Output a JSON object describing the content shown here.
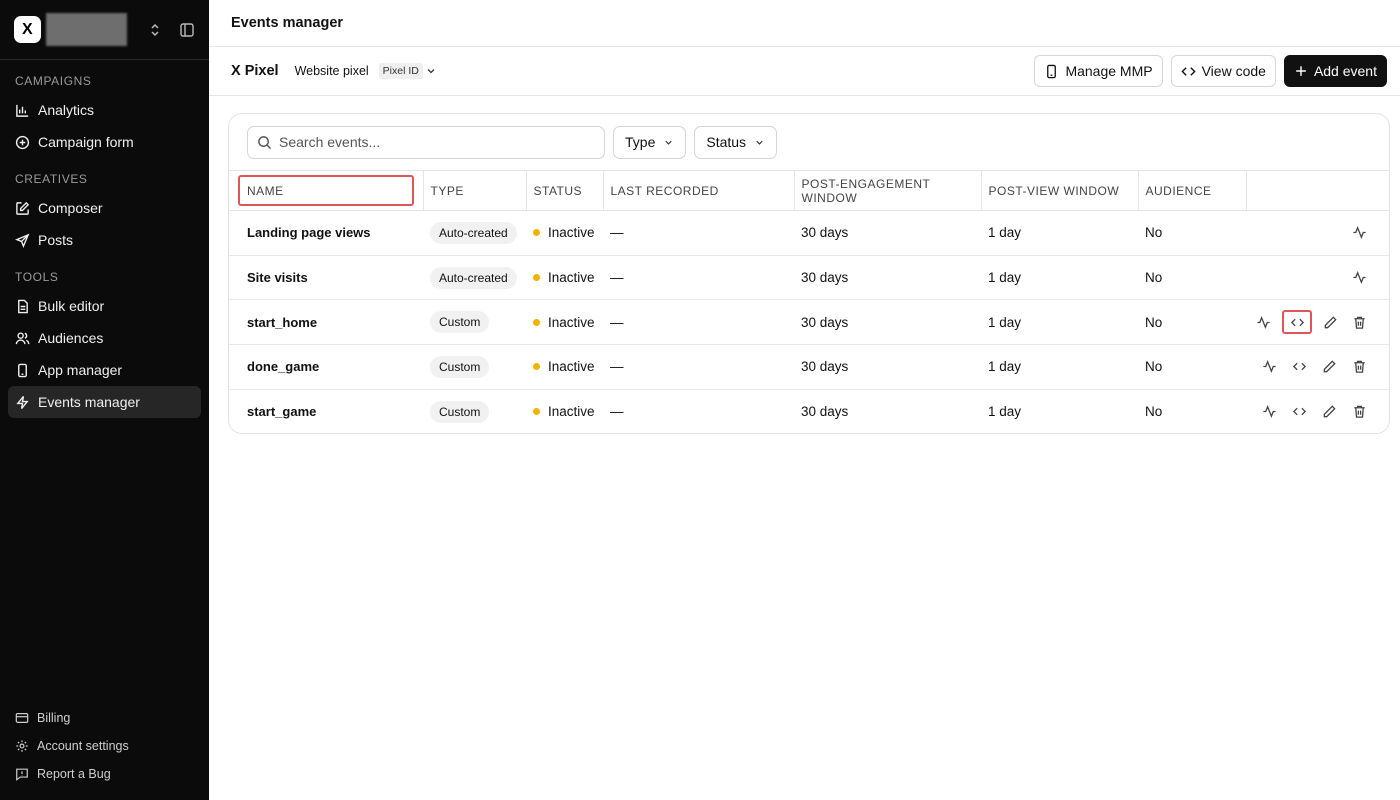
{
  "sidebar": {
    "logo": "X",
    "sections": [
      {
        "title": "CAMPAIGNS",
        "items": [
          {
            "label": "Analytics",
            "icon": "bar-chart-icon"
          },
          {
            "label": "Campaign form",
            "icon": "plus-circle-icon"
          }
        ]
      },
      {
        "title": "CREATIVES",
        "items": [
          {
            "label": "Composer",
            "icon": "edit-square-icon"
          },
          {
            "label": "Posts",
            "icon": "send-icon"
          }
        ]
      },
      {
        "title": "TOOLS",
        "items": [
          {
            "label": "Bulk editor",
            "icon": "file-icon"
          },
          {
            "label": "Audiences",
            "icon": "users-icon"
          },
          {
            "label": "App manager",
            "icon": "smartphone-icon"
          },
          {
            "label": "Events manager",
            "icon": "zap-icon",
            "active": true
          }
        ]
      }
    ],
    "bottom": [
      {
        "label": "Billing",
        "icon": "credit-card-icon"
      },
      {
        "label": "Account settings",
        "icon": "gear-icon"
      },
      {
        "label": "Report a Bug",
        "icon": "message-alert-icon"
      }
    ]
  },
  "header": {
    "title": "Events manager"
  },
  "pixel": {
    "name": "X Pixel",
    "type": "Website pixel",
    "id_label": "Pixel ID"
  },
  "actions": {
    "manage_mmp": "Manage MMP",
    "view_code": "View code",
    "add_event": "Add event"
  },
  "filters": {
    "search_placeholder": "Search events...",
    "type": "Type",
    "status": "Status"
  },
  "table": {
    "columns": [
      "NAME",
      "TYPE",
      "STATUS",
      "LAST RECORDED",
      "POST-ENGAGEMENT WINDOW",
      "POST-VIEW WINDOW",
      "AUDIENCE",
      ""
    ],
    "rows": [
      {
        "name": "Landing page views",
        "type": "Auto-created",
        "status": "Inactive",
        "last_recorded": "—",
        "engagement": "30 days",
        "view": "1 day",
        "audience": "No",
        "full_actions": false
      },
      {
        "name": "Site visits",
        "type": "Auto-created",
        "status": "Inactive",
        "last_recorded": "—",
        "engagement": "30 days",
        "view": "1 day",
        "audience": "No",
        "full_actions": false
      },
      {
        "name": "start_home",
        "type": "Custom",
        "status": "Inactive",
        "last_recorded": "—",
        "engagement": "30 days",
        "view": "1 day",
        "audience": "No",
        "full_actions": true
      },
      {
        "name": "done_game",
        "type": "Custom",
        "status": "Inactive",
        "last_recorded": "—",
        "engagement": "30 days",
        "view": "1 day",
        "audience": "No",
        "full_actions": true
      },
      {
        "name": "start_game",
        "type": "Custom",
        "status": "Inactive",
        "last_recorded": "—",
        "engagement": "30 days",
        "view": "1 day",
        "audience": "No",
        "full_actions": true
      }
    ]
  },
  "colors": {
    "status_inactive": "#f2b200",
    "highlight": "#e05555"
  }
}
